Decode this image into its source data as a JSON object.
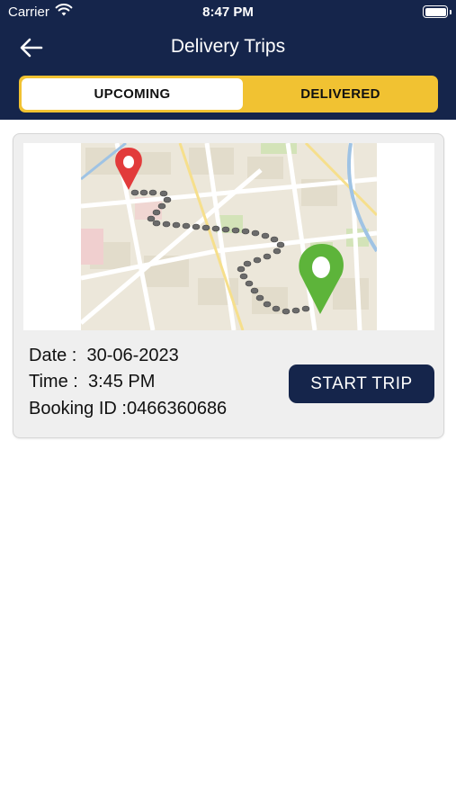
{
  "status_bar": {
    "carrier": "Carrier",
    "time": "8:47 PM"
  },
  "header": {
    "title": "Delivery Trips",
    "back_icon": "arrow-left-icon"
  },
  "tabs": [
    {
      "label": "UPCOMING",
      "active": true
    },
    {
      "label": "DELIVERED",
      "active": false
    }
  ],
  "trip": {
    "date_label": "Date :",
    "date_value": "30-06-2023",
    "time_label": "Time :",
    "time_value": "3:45 PM",
    "booking_label": "Booking ID :",
    "booking_value": "0466360686",
    "start_button": "START TRIP"
  },
  "colors": {
    "header_bg": "#15254b",
    "tab_accent": "#f1c232",
    "button_bg": "#15254b"
  }
}
